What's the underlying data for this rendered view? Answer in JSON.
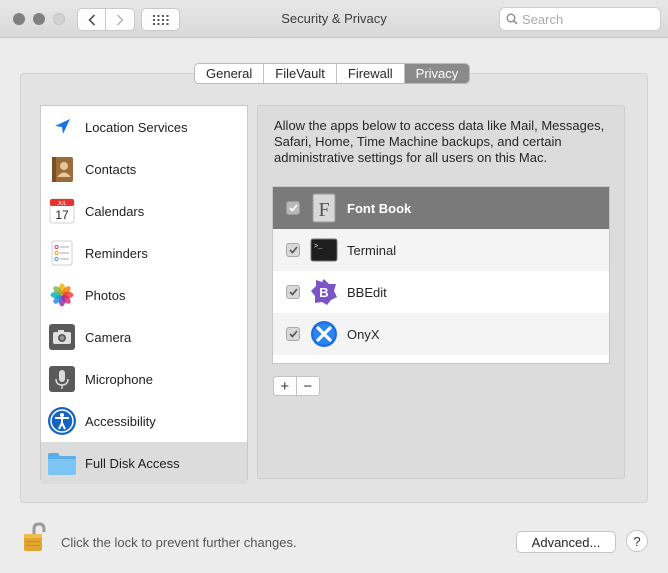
{
  "window": {
    "title": "Security & Privacy",
    "search_placeholder": "Search"
  },
  "tabs": [
    {
      "label": "General",
      "active": false
    },
    {
      "label": "FileVault",
      "active": false
    },
    {
      "label": "Firewall",
      "active": false
    },
    {
      "label": "Privacy",
      "active": true
    }
  ],
  "sidebar": {
    "items": [
      {
        "label": "Location Services",
        "icon": "location-arrow-icon"
      },
      {
        "label": "Contacts",
        "icon": "contacts-book-icon"
      },
      {
        "label": "Calendars",
        "icon": "calendar-icon",
        "icon_month": "JUL",
        "icon_day": "17"
      },
      {
        "label": "Reminders",
        "icon": "reminders-list-icon"
      },
      {
        "label": "Photos",
        "icon": "photos-flower-icon"
      },
      {
        "label": "Camera",
        "icon": "camera-icon"
      },
      {
        "label": "Microphone",
        "icon": "microphone-icon"
      },
      {
        "label": "Accessibility",
        "icon": "accessibility-icon"
      },
      {
        "label": "Full Disk Access",
        "icon": "folder-icon",
        "selected": true
      }
    ]
  },
  "pane": {
    "description": "Allow the apps below to access data like Mail, Messages, Safari, Home, Time Machine backups, and certain administrative settings for all users on this Mac.",
    "apps": [
      {
        "name": "Font Book",
        "checked": true,
        "selected": true,
        "icon": "font-book-icon",
        "glyph": "F"
      },
      {
        "name": "Terminal",
        "checked": true,
        "icon": "terminal-icon",
        "glyph": ">_"
      },
      {
        "name": "BBEdit",
        "checked": true,
        "icon": "bbedit-icon",
        "glyph": "B"
      },
      {
        "name": "OnyX",
        "checked": true,
        "icon": "onyx-icon"
      }
    ],
    "add_label": "+",
    "remove_label": "−"
  },
  "footer": {
    "lock_text": "Click the lock to prevent further changes.",
    "advanced_label": "Advanced...",
    "help_label": "?"
  },
  "colors": {
    "accent_selected": "#7a7a7a",
    "window_bg": "#ececec",
    "lock_gold": "#e2a530"
  }
}
